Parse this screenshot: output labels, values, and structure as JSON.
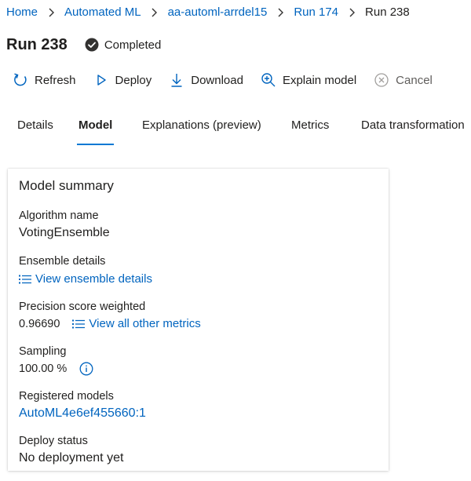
{
  "breadcrumb": {
    "items": [
      "Home",
      "Automated ML",
      "aa-automl-arrdel15",
      "Run 174",
      "Run 238"
    ]
  },
  "header": {
    "title": "Run 238",
    "status": "Completed"
  },
  "toolbar": {
    "refresh": "Refresh",
    "deploy": "Deploy",
    "download": "Download",
    "explain": "Explain model",
    "cancel": "Cancel"
  },
  "tabs": [
    "Details",
    "Model",
    "Explanations (preview)",
    "Metrics",
    "Data transformation"
  ],
  "active_tab": "Model",
  "model_summary": {
    "title": "Model summary",
    "algorithm_label": "Algorithm name",
    "algorithm_value": "VotingEnsemble",
    "ensemble_label": "Ensemble details",
    "ensemble_link": "View ensemble details",
    "precision_label": "Precision score weighted",
    "precision_value": "0.96690",
    "metrics_link": "View all other metrics",
    "sampling_label": "Sampling",
    "sampling_value": "100.00 %",
    "registered_label": "Registered models",
    "registered_value": "AutoML4e6ef455660:1",
    "deploy_status_label": "Deploy status",
    "deploy_status_value": "No deployment yet"
  },
  "colors": {
    "link": "#0064bf",
    "accent": "#0078d4",
    "status_icon": "#323130"
  },
  "icons": [
    "chevron-right-icon",
    "completed-check-icon",
    "refresh-icon",
    "play-icon",
    "download-icon",
    "zoom-in-icon",
    "cancel-icon",
    "list-icon",
    "info-icon"
  ]
}
